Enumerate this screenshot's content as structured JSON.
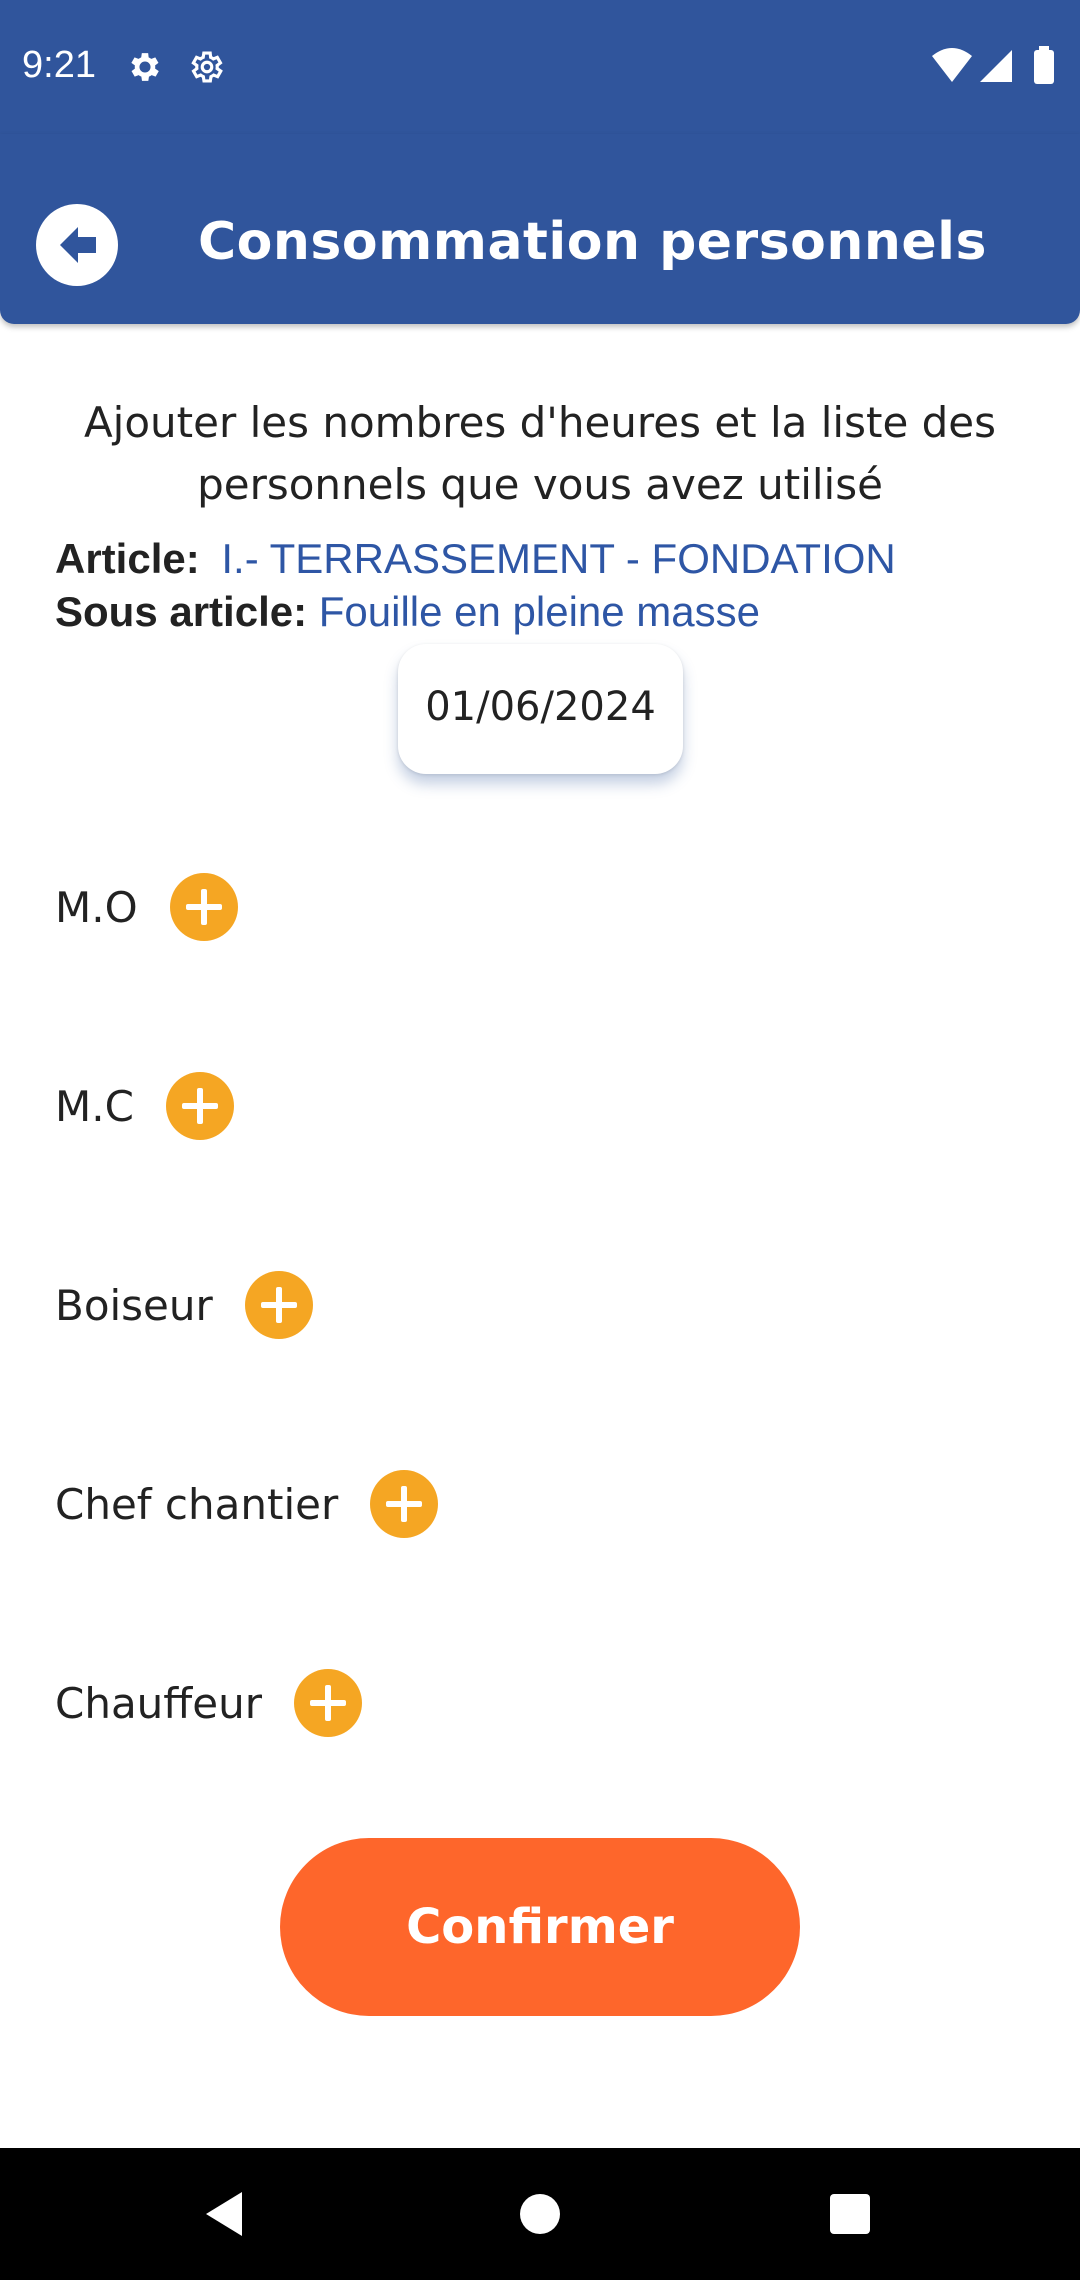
{
  "status_bar": {
    "time": "9:21",
    "icons": [
      "settings-icon",
      "settings-outline-icon",
      "wifi-icon",
      "cellular-signal-icon",
      "battery-icon"
    ]
  },
  "app_bar": {
    "title": "Consommation personnels",
    "back_icon": "arrow-left-circle-icon"
  },
  "intro": {
    "text": "Ajouter les nombres d'heures et la liste des personnels que vous avez utilisé"
  },
  "article": {
    "label": "Article:",
    "value": "I.- TERRASSEMENT - FONDATION"
  },
  "sous_article": {
    "label": "Sous article:",
    "value": "Fouille en pleine masse"
  },
  "date": "01/06/2024",
  "roles": [
    {
      "label": "M.O"
    },
    {
      "label": "M.C"
    },
    {
      "label": "Boiseur"
    },
    {
      "label": "Chef chantier"
    },
    {
      "label": "Chauffeur"
    }
  ],
  "add_icon": "plus-circle-icon",
  "confirm_label": "Confirmer",
  "nav_bar": {
    "icons": [
      "back-triangle-icon",
      "home-circle-icon",
      "recents-square-icon"
    ]
  },
  "colors": {
    "primary": "#30559c",
    "accent_link": "#2e56a5",
    "add_button": "#f5a623",
    "confirm_button": "#fe662b"
  }
}
